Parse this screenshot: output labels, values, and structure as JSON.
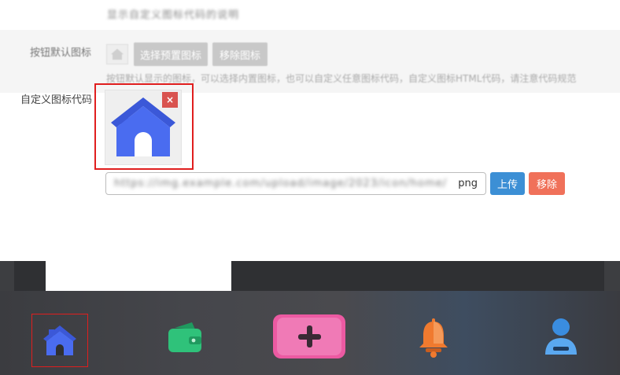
{
  "form": {
    "top_text_blurred": "显示自定义图标代码的说明",
    "button_icon_label": "按钮默认图标",
    "choose_preset_label": "选择预置图标",
    "remove_icon_label": "移除图标",
    "helper_text": "按钮默认显示的图标，可以选择内置图标，也可以自定义任意图标代码，自定义图标HTML代码，请注意代码规范",
    "custom_icon_label": "自定义图标代码",
    "remove_x": "×",
    "url_blurred": "https://img.example.com/upload/image/2023/icon/home/",
    "url_ext": "png",
    "upload_label": "上传",
    "delete_label": "移除"
  },
  "colors": {
    "home_blue": "#4a6cf0",
    "wallet_green": "#2fc27a",
    "add_pink": "#ec5aa2",
    "bell_orange": "#f07a2f",
    "user_blue": "#3a8de0",
    "highlight_red": "#e01e1e"
  },
  "tabbar": {
    "items": [
      {
        "icon": "home-icon",
        "selected": true
      },
      {
        "icon": "wallet-icon",
        "selected": false
      },
      {
        "icon": "add-icon",
        "selected": false
      },
      {
        "icon": "bell-icon",
        "selected": false
      },
      {
        "icon": "user-icon",
        "selected": false
      }
    ]
  }
}
